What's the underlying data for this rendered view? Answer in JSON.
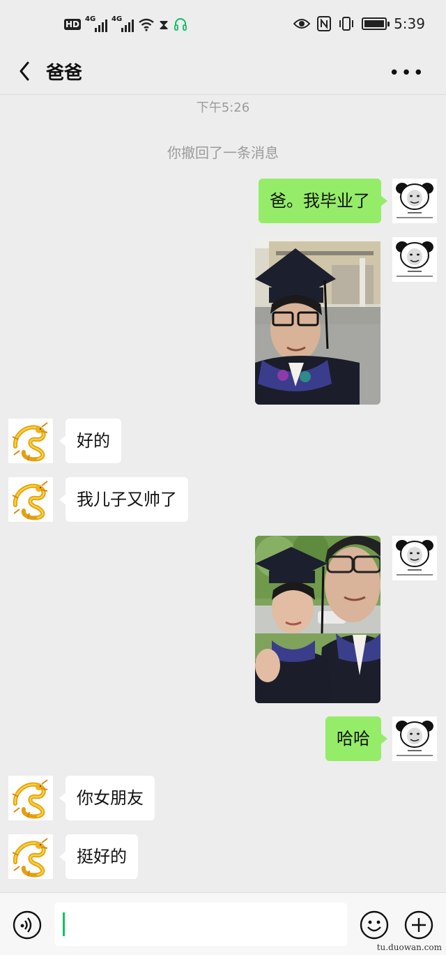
{
  "status_bar": {
    "time": "5:39",
    "hd_label": "HD",
    "network_label_1": "4G",
    "network_label_2": "4G"
  },
  "header": {
    "title": "爸爸",
    "back_icon": "chevron-left-icon",
    "more_icon": "more-dots-icon"
  },
  "chat": {
    "timestamp": "下午5:26",
    "recall_notice": "你撤回了一条消息",
    "messages": [
      {
        "side": "right",
        "type": "text",
        "text": "爸。我毕业了"
      },
      {
        "side": "right",
        "type": "image",
        "description": "graduation-selfie"
      },
      {
        "side": "left",
        "type": "text",
        "text": "好的"
      },
      {
        "side": "left",
        "type": "text",
        "text": "我儿子又帅了"
      },
      {
        "side": "right",
        "type": "image",
        "description": "couple-graduation-photo"
      },
      {
        "side": "right",
        "type": "text",
        "text": "哈哈"
      },
      {
        "side": "left",
        "type": "text",
        "text": "你女朋友"
      },
      {
        "side": "left",
        "type": "text",
        "text": "挺好的"
      }
    ]
  },
  "input_bar": {
    "voice_icon": "voice-icon",
    "emoji_icon": "emoji-icon",
    "plus_icon": "plus-icon",
    "value": ""
  },
  "watermark": "tu.duowan.com",
  "colors": {
    "background": "#ededed",
    "own_bubble": "#95ec69",
    "other_bubble": "#ffffff",
    "caret": "#07c160"
  }
}
